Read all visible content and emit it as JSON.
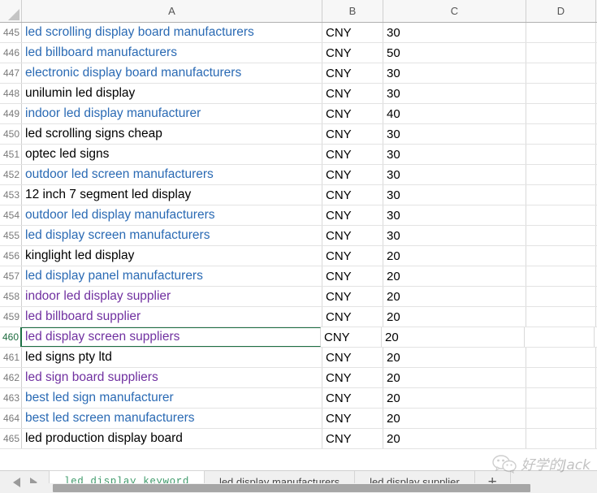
{
  "app": "spreadsheet",
  "columns": {
    "headers": [
      "A",
      "B",
      "C",
      "D"
    ]
  },
  "selection": {
    "active_cell": "A460",
    "active_row": 460,
    "selection_color": "#1d7044"
  },
  "colors": {
    "hyperlink": "#2a6ab4",
    "visited_hyperlink": "#7030a0",
    "plain_text": "#000000",
    "row_number": "#7a7a7a",
    "grid_line": "#d9d9d9",
    "header_bg": "#f7f7f7",
    "tab_active_text": "#3f9b6b"
  },
  "rows": [
    {
      "num": "445",
      "a": "led scrolling display board manufacturers",
      "style": "link",
      "b": "CNY",
      "c": "30",
      "d": ""
    },
    {
      "num": "446",
      "a": "led billboard manufacturers",
      "style": "link",
      "b": "CNY",
      "c": "50",
      "d": ""
    },
    {
      "num": "447",
      "a": "electronic display board manufacturers",
      "style": "link",
      "b": "CNY",
      "c": "30",
      "d": ""
    },
    {
      "num": "448",
      "a": "unilumin led display",
      "style": "plain",
      "b": "CNY",
      "c": "30",
      "d": ""
    },
    {
      "num": "449",
      "a": "indoor led display manufacturer",
      "style": "link",
      "b": "CNY",
      "c": "40",
      "d": ""
    },
    {
      "num": "450",
      "a": "led scrolling signs cheap",
      "style": "plain",
      "b": "CNY",
      "c": "30",
      "d": ""
    },
    {
      "num": "451",
      "a": "optec led signs",
      "style": "plain",
      "b": "CNY",
      "c": "30",
      "d": ""
    },
    {
      "num": "452",
      "a": "outdoor led screen manufacturers",
      "style": "link",
      "b": "CNY",
      "c": "30",
      "d": ""
    },
    {
      "num": "453",
      "a": "12 inch 7 segment led display",
      "style": "plain",
      "b": "CNY",
      "c": "30",
      "d": ""
    },
    {
      "num": "454",
      "a": "outdoor led display manufacturers",
      "style": "link",
      "b": "CNY",
      "c": "30",
      "d": ""
    },
    {
      "num": "455",
      "a": "led display screen manufacturers",
      "style": "link",
      "b": "CNY",
      "c": "30",
      "d": ""
    },
    {
      "num": "456",
      "a": "kinglight led display",
      "style": "plain",
      "b": "CNY",
      "c": "20",
      "d": ""
    },
    {
      "num": "457",
      "a": "led display panel manufacturers",
      "style": "link",
      "b": "CNY",
      "c": "20",
      "d": ""
    },
    {
      "num": "458",
      "a": "indoor led display supplier",
      "style": "visited",
      "b": "CNY",
      "c": "20",
      "d": ""
    },
    {
      "num": "459",
      "a": "led billboard supplier",
      "style": "visited",
      "b": "CNY",
      "c": "20",
      "d": ""
    },
    {
      "num": "460",
      "a": "led display screen suppliers",
      "style": "visited",
      "b": "CNY",
      "c": "20",
      "d": ""
    },
    {
      "num": "461",
      "a": "led signs pty ltd",
      "style": "plain",
      "b": "CNY",
      "c": "20",
      "d": ""
    },
    {
      "num": "462",
      "a": "led sign board suppliers",
      "style": "visited",
      "b": "CNY",
      "c": "20",
      "d": ""
    },
    {
      "num": "463",
      "a": "best led sign manufacturer",
      "style": "link",
      "b": "CNY",
      "c": "20",
      "d": ""
    },
    {
      "num": "464",
      "a": "best led screen manufacturers",
      "style": "link",
      "b": "CNY",
      "c": "20",
      "d": ""
    },
    {
      "num": "465",
      "a": "led production display board",
      "style": "plain",
      "b": "CNY",
      "c": "20",
      "d": ""
    }
  ],
  "tabbar": {
    "prev_label": "",
    "next_label": "",
    "tabs": [
      {
        "label": "led display keyword",
        "active": true
      },
      {
        "label": "led display manufacturers",
        "active": false
      },
      {
        "label": "led display supplier",
        "active": false
      }
    ],
    "add_label": "+"
  },
  "watermark": {
    "text": "好学的Jack"
  }
}
